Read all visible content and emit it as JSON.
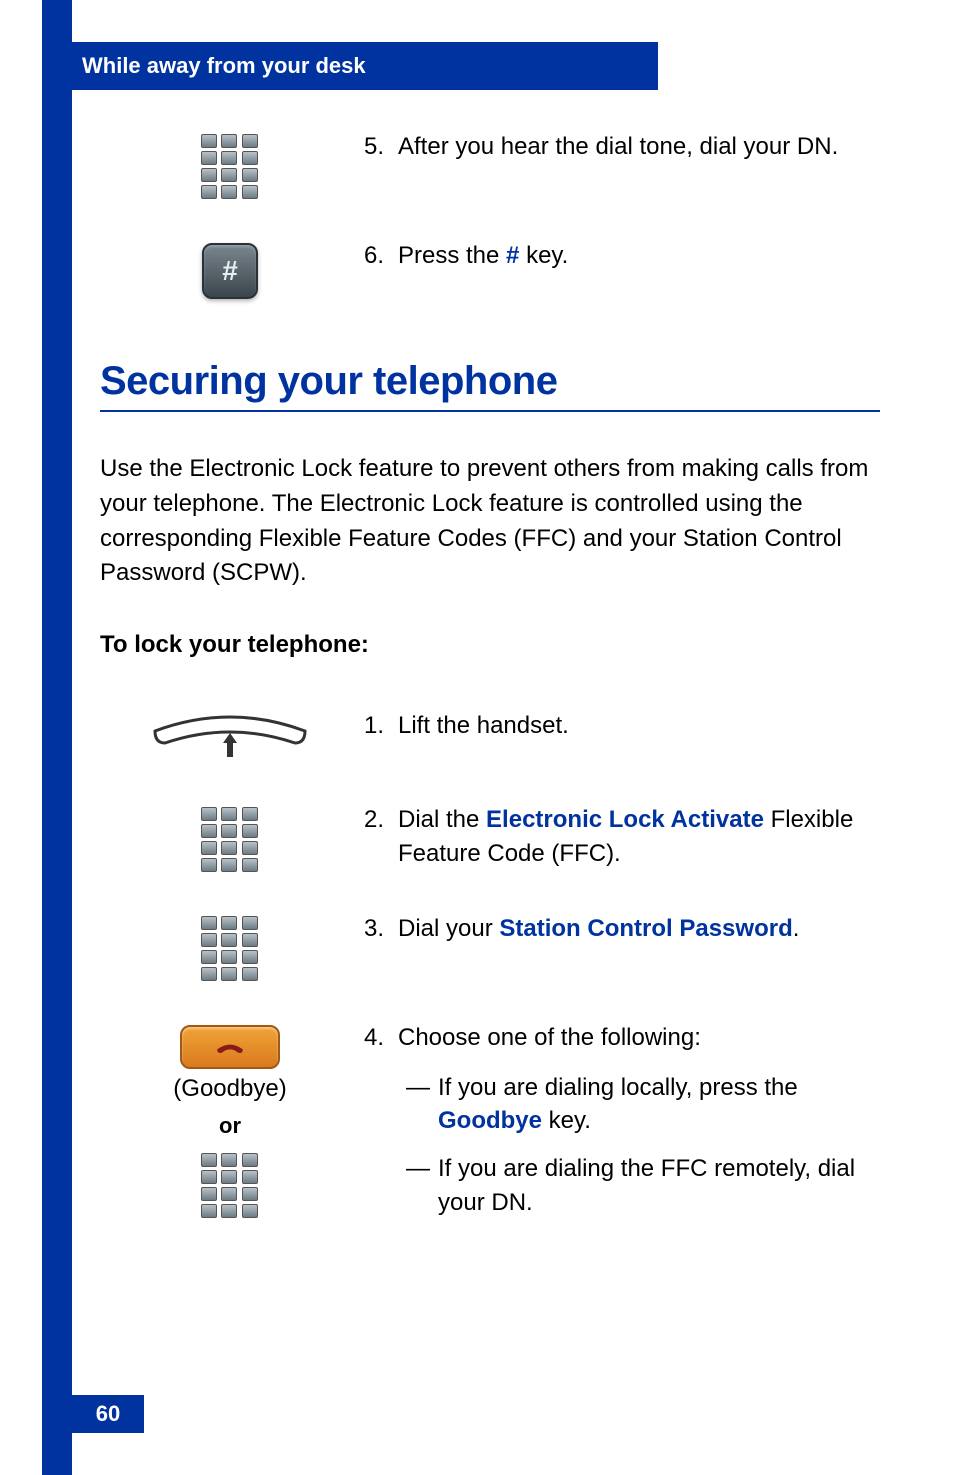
{
  "header": {
    "title": "While away from your desk"
  },
  "top_steps": [
    {
      "num": "5.",
      "text": "After you hear the dial tone, dial your DN."
    },
    {
      "num": "6.",
      "prefix": "Press the ",
      "key": "#",
      "suffix": " key."
    }
  ],
  "section": {
    "title": "Securing your telephone",
    "intro": "Use the Electronic Lock feature to prevent others from making calls from your telephone. The Electronic Lock feature is controlled using the corresponding Flexible Feature Codes (FFC) and your Station Control Password (SCPW).",
    "subhead": "To lock your telephone:"
  },
  "lock_steps": {
    "s1": {
      "num": "1.",
      "text": "Lift the handset."
    },
    "s2": {
      "num": "2.",
      "prefix": "Dial the ",
      "em": "Electronic Lock Activate",
      "suffix": " Flexible Feature Code (FFC)."
    },
    "s3": {
      "num": "3.",
      "prefix": "Dial your ",
      "em": "Station Control Password",
      "suffix": "."
    },
    "s4": {
      "num": "4.",
      "lead": "Choose one of the following:",
      "a_prefix": "If you are dialing locally, press the ",
      "a_em": "Goodbye",
      "a_suffix": " key.",
      "b": "If you are dialing the FFC remotely, dial your DN."
    }
  },
  "goodbye": {
    "caption": "(Goodbye)",
    "or": "or"
  },
  "hash_glyph": "#",
  "page_number": "60"
}
